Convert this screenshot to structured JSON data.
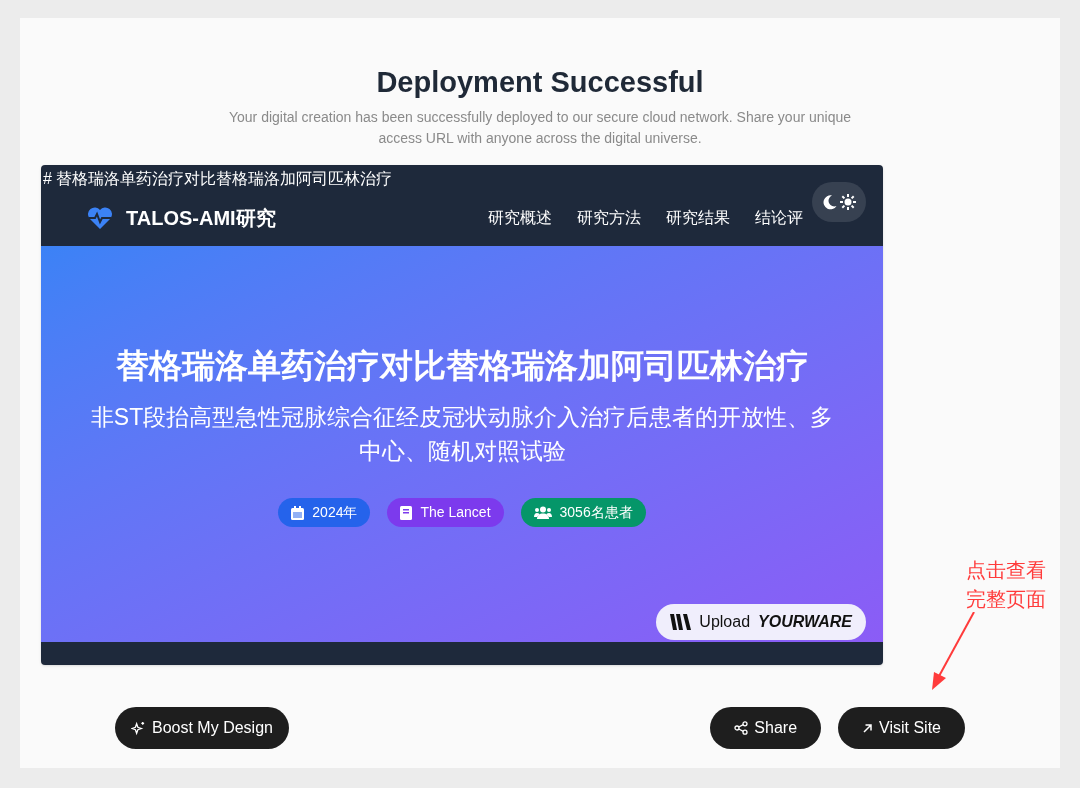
{
  "header": {
    "title": "Deployment Successful",
    "subtitle": "Your digital creation has been successfully deployed to our secure cloud network. Share your unique access URL with anyone across the digital universe."
  },
  "preview": {
    "page_title": "# 替格瑞洛单药治疗对比替格瑞洛加阿司匹林治疗",
    "brand": "TALOS-AMI研究",
    "nav": [
      {
        "label": "研究概述"
      },
      {
        "label": "研究方法"
      },
      {
        "label": "研究结果"
      },
      {
        "label": "结论评"
      }
    ],
    "hero_title": "替格瑞洛单药治疗对比替格瑞洛加阿司匹林治疗",
    "hero_subtitle": "非ST段抬高型急性冠脉综合征经皮冠状动脉介入治疗后患者的开放性、多中心、随机对照试验",
    "badges": [
      {
        "kind": "calendar",
        "label": "2024年",
        "color": "#2563eb"
      },
      {
        "kind": "book",
        "label": "The Lancet",
        "color": "#7c3aed"
      },
      {
        "kind": "people",
        "label": "3056名患者",
        "color": "#059669"
      }
    ],
    "upload": {
      "label": "Upload",
      "brand": "YOURWARE"
    }
  },
  "actions": [
    {
      "kind": "boost",
      "label": "Boost My Design"
    },
    {
      "kind": "share",
      "label": "Share"
    },
    {
      "kind": "visit",
      "label": "Visit Site"
    }
  ],
  "annotation": {
    "text": "点击查看完整页面"
  }
}
